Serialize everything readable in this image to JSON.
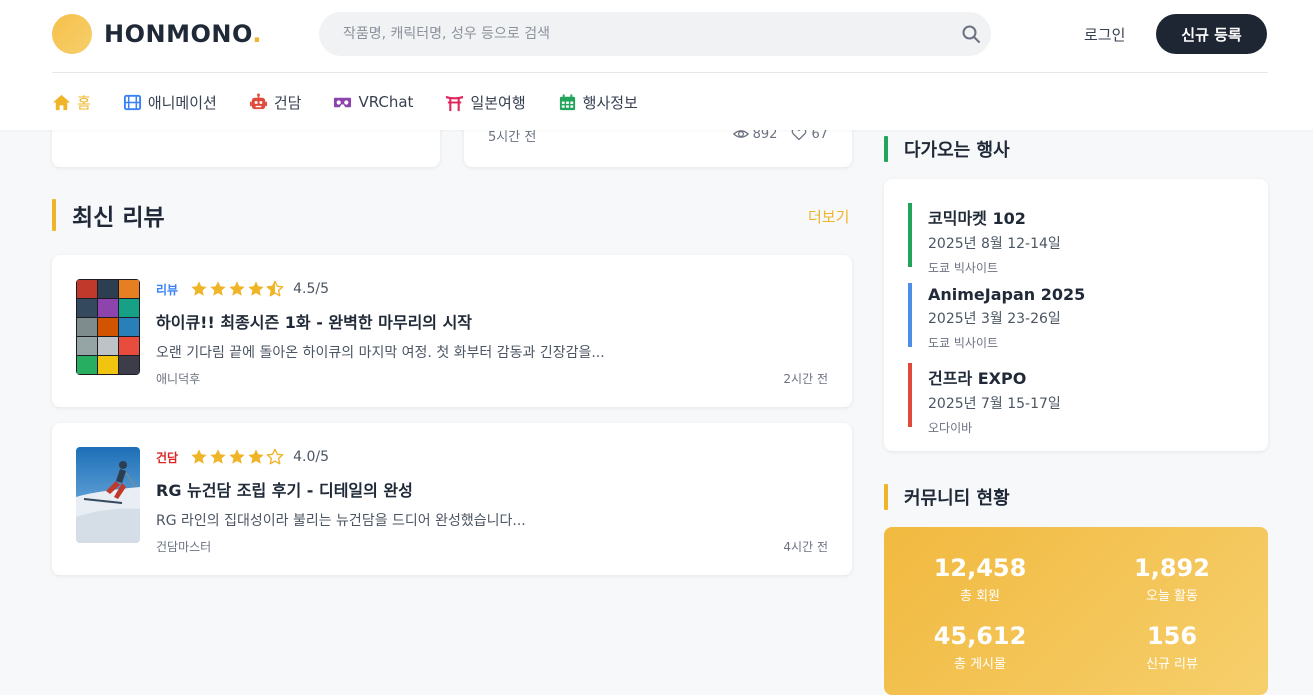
{
  "header": {
    "logo_text": "HONMONO",
    "logo_dot": ".",
    "search_placeholder": "작품명, 캐릭터명, 성우 등으로 검색",
    "login_label": "로그인",
    "signup_label": "신규 등록",
    "accent_color": "#f0b429",
    "dark_button_color": "#1e2533"
  },
  "nav": {
    "items": [
      {
        "label": "홈",
        "icon": "home-icon",
        "active": true
      },
      {
        "label": "애니메이션",
        "icon": "film-icon"
      },
      {
        "label": "건담",
        "icon": "robot-icon"
      },
      {
        "label": "VRChat",
        "icon": "vr-goggles-icon"
      },
      {
        "label": "일본여행",
        "icon": "torii-gate-icon"
      },
      {
        "label": "행사정보",
        "icon": "calendar-icon"
      }
    ]
  },
  "top_cards": {
    "right": {
      "time": "5시간 전",
      "views": "892",
      "likes": "67"
    }
  },
  "latest_reviews": {
    "title": "최신 리뷰",
    "more_label": "더보기",
    "items": [
      {
        "category": "리뷰",
        "category_color": "#3b82f6",
        "rating": 4.5,
        "score": "4.5/5",
        "title": "하이큐!! 최종시즌 1화 - 완벽한 마무리의 시작",
        "excerpt": "오랜 기다림 끝에 돌아온 하이큐의 마지막 여정. 첫 화부터 감동과 긴장감을...",
        "author": "애니덕후",
        "time": "2시간 전"
      },
      {
        "category": "건담",
        "category_color": "#dc2626",
        "rating": 4.0,
        "score": "4.0/5",
        "title": "RG 뉴건담 조립 후기 - 디테일의 완성",
        "excerpt": "RG 라인의 집대성이라 불리는 뉴건담을 드디어 완성했습니다...",
        "author": "건담마스터",
        "time": "4시간 전"
      }
    ]
  },
  "events": {
    "title": "다가오는 행사",
    "items": [
      {
        "name": "코믹마켓 102",
        "date": "2025년 8월 12-14일",
        "place": "도쿄 빅사이트",
        "color": "#22a55b"
      },
      {
        "name": "AnimeJapan 2025",
        "date": "2025년 3월 23-26일",
        "place": "도쿄 빅사이트",
        "color": "#4a8ee6"
      },
      {
        "name": "건프라 EXPO",
        "date": "2025년 7월 15-17일",
        "place": "오다이바",
        "color": "#e04a3a"
      }
    ]
  },
  "community": {
    "title": "커뮤니티 현황",
    "stats": [
      {
        "value": "12,458",
        "label": "총 회원"
      },
      {
        "value": "1,892",
        "label": "오늘 활동"
      },
      {
        "value": "45,612",
        "label": "총 게시물"
      },
      {
        "value": "156",
        "label": "신규 리뷰"
      }
    ]
  }
}
